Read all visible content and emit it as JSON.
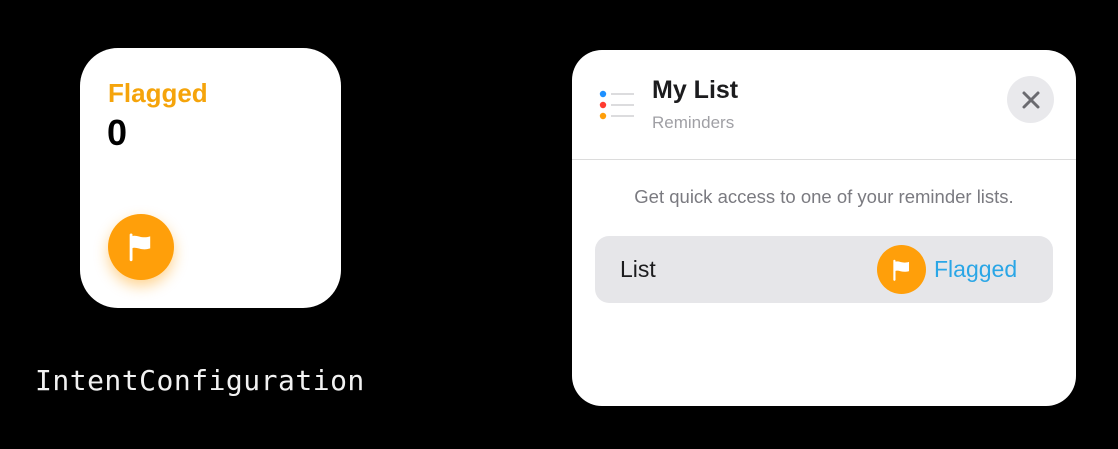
{
  "widget": {
    "title": "Flagged",
    "count": "0",
    "icon": "flag-icon",
    "accent_color": "#FF9F0A"
  },
  "caption": "IntentConfiguration",
  "config_panel": {
    "icon": "list-icon",
    "title": "My List",
    "subtitle": "Reminders",
    "close_icon": "close-icon",
    "description": "Get quick access to one of your reminder lists.",
    "parameter": {
      "label": "List",
      "value": "Flagged",
      "value_icon": "flag-icon",
      "value_color": "#2AA6E6"
    }
  }
}
